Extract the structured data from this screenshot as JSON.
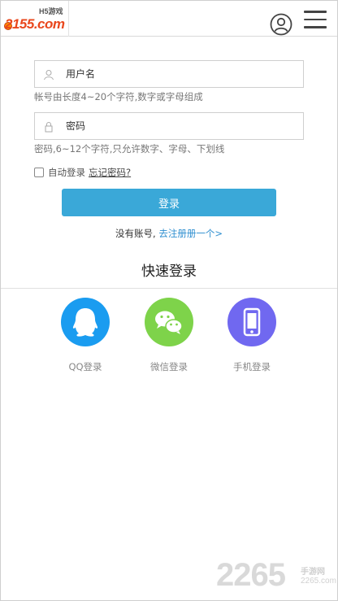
{
  "header": {
    "logo_text": "2155.com",
    "logo_sub": "H5游戏",
    "user_icon": "user-circle-icon",
    "menu_icon": "hamburger-menu-icon"
  },
  "form": {
    "username": {
      "placeholder": "用户名",
      "value": "",
      "icon": "user-icon"
    },
    "username_hint": "帐号由长度4~20个字符,数字或字母组成",
    "password": {
      "placeholder": "密码",
      "value": "",
      "icon": "lock-icon"
    },
    "password_hint": "密码,6~12个字符,只允许数字、字母、下划线",
    "remember_label": "自动登录",
    "remember_checked": false,
    "forgot_label": "忘记密码?",
    "login_label": "登录",
    "no_account_text": "没有账号,",
    "register_link": "去注册册一个>"
  },
  "quick_login": {
    "title": "快速登录",
    "options": [
      {
        "label": "QQ登录",
        "icon": "qq-icon",
        "color": "#1a9cf0"
      },
      {
        "label": "微信登录",
        "icon": "wechat-icon",
        "color": "#7ed34a"
      },
      {
        "label": "手机登录",
        "icon": "phone-icon",
        "color": "#7068f0"
      }
    ]
  },
  "watermark": {
    "number": "2265",
    "label": "手游网",
    "url": "2265.com"
  },
  "colors": {
    "primary_button": "#3aa8d8",
    "link": "#2f8fd0",
    "logo": "#e9471d"
  }
}
